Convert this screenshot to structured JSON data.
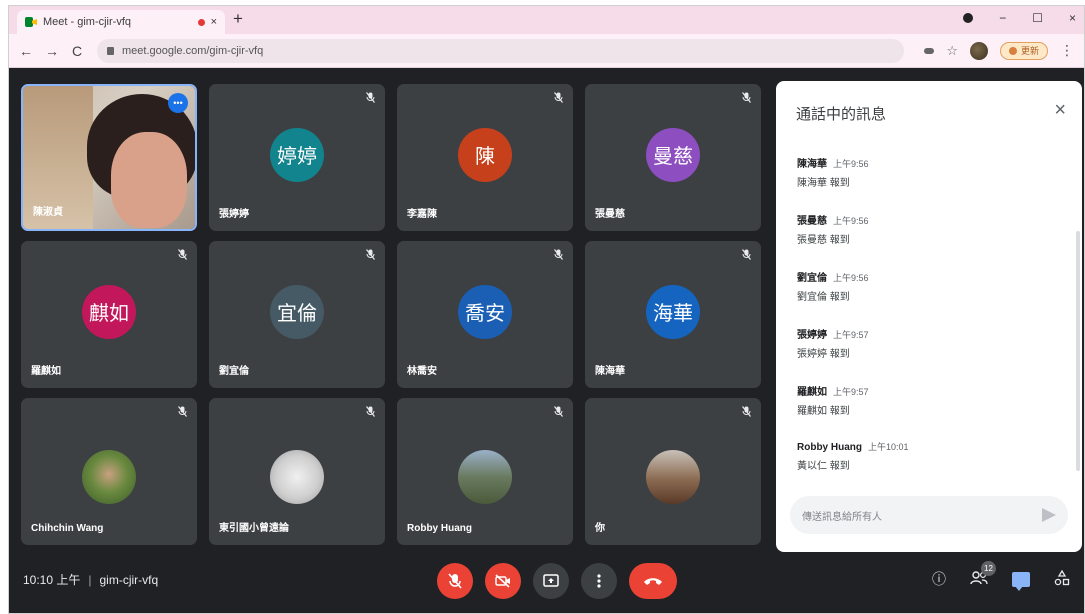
{
  "browser": {
    "tab_title": "Meet - gim-cjir-vfq",
    "tab_close": "×",
    "new_tab": "+",
    "url": "meet.google.com/gim-cjir-vfq",
    "back": "←",
    "forward": "→",
    "reload": "C",
    "star": "☆",
    "update_label": "更新",
    "menu": "⋮",
    "win_min": "−",
    "win_max": "☐",
    "win_close": "×"
  },
  "tiles": [
    {
      "name": "陳淑貞",
      "type": "camera"
    },
    {
      "name": "張婷婷",
      "initials": "婷婷",
      "color": "#12848e"
    },
    {
      "name": "李嘉陳",
      "initials": "陳",
      "color": "#c6401c"
    },
    {
      "name": "張曼慈",
      "initials": "曼慈",
      "color": "#8d4ec0"
    },
    {
      "name": "羅麒如",
      "initials": "麒如",
      "color": "#c2185b"
    },
    {
      "name": "劉宜倫",
      "initials": "宜倫",
      "color": "#455a64"
    },
    {
      "name": "林喬安",
      "initials": "喬安",
      "color": "#1a5fb4"
    },
    {
      "name": "陳海華",
      "initials": "海華",
      "color": "#1565c0"
    },
    {
      "name": "Chihchin Wang",
      "type": "photo"
    },
    {
      "name": "東引國小曾遠論",
      "type": "photo"
    },
    {
      "name": "Robby Huang",
      "type": "photo"
    },
    {
      "name": "你",
      "type": "photo"
    }
  ],
  "mic_off_icon": "mic-off-icon",
  "chat": {
    "title": "通話中的訊息",
    "close": "×",
    "messages": [
      {
        "sender": "陳海華",
        "time": "上午9:56",
        "text": "陳海華 報到"
      },
      {
        "sender": "張曼慈",
        "time": "上午9:56",
        "text": "張曼慈 報到"
      },
      {
        "sender": "劉宜倫",
        "time": "上午9:56",
        "text": "劉宜倫 報到"
      },
      {
        "sender": "張婷婷",
        "time": "上午9:57",
        "text": "張婷婷 報到"
      },
      {
        "sender": "羅麒如",
        "time": "上午9:57",
        "text": "羅麒如 報到"
      },
      {
        "sender": "Robby Huang",
        "time": "上午10:01",
        "text": "黃以仁 報到"
      }
    ],
    "input_placeholder": "傳送訊息給所有人"
  },
  "bottom": {
    "time": "10:10 上午",
    "separator": "|",
    "meeting_code": "gim-cjir-vfq",
    "participant_count": "12",
    "info_icon": "ⓘ"
  },
  "colors": {
    "background": "#202124",
    "tile": "#3c4043",
    "danger": "#ea4335",
    "accent": "#8ab4f8"
  }
}
